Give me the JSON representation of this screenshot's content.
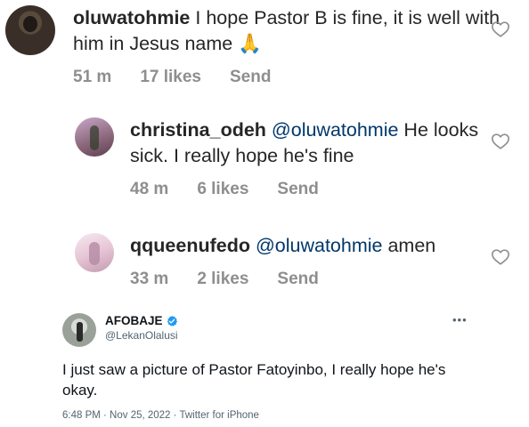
{
  "comments": [
    {
      "username": "oluwatohmie",
      "mention": "",
      "text": " I hope Pastor B is fine, it is well with him in Jesus name 🙏",
      "time": "51 m",
      "likes": "17 likes",
      "reply": "Send"
    },
    {
      "username": "christina_odeh",
      "mention": " @oluwatohmie",
      "text": " He looks sick. I really hope he's fine",
      "time": "48 m",
      "likes": "6 likes",
      "reply": "Send"
    },
    {
      "username": "qqueenufedo",
      "mention": " @oluwatohmie",
      "text": " amen",
      "time": "33 m",
      "likes": "2 likes",
      "reply": "Send"
    }
  ],
  "tweet": {
    "name": "AFOBAJE",
    "handle": "@LekanOlalusi",
    "more": "•••",
    "text": "I just saw a picture of Pastor Fatoyinbo, I really hope he's okay.",
    "footer": "6:48 PM · Nov 25, 2022 · Twitter for iPhone"
  },
  "colors": {
    "text": "#262626",
    "mention": "#00376b",
    "meta": "#8e8e8e",
    "verified": "#1d9bf0"
  },
  "icons": [
    "heart-icon",
    "verified-badge-icon",
    "more-icon"
  ]
}
